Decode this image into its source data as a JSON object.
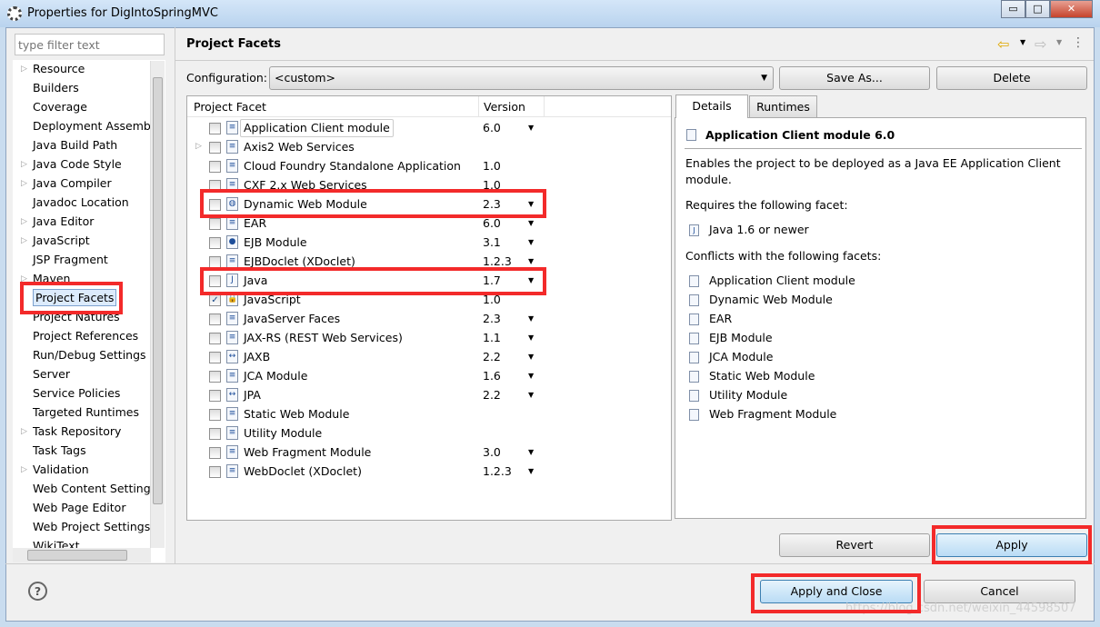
{
  "window": {
    "title": "Properties for DigIntoSpringMVC",
    "minimize": "▭",
    "maximize": "□",
    "close": "✕"
  },
  "sidebar": {
    "filter_placeholder": "type filter text",
    "items": [
      {
        "label": "Resource",
        "expandable": true
      },
      {
        "label": "Builders"
      },
      {
        "label": "Coverage"
      },
      {
        "label": "Deployment Assembly"
      },
      {
        "label": "Java Build Path"
      },
      {
        "label": "Java Code Style",
        "expandable": true
      },
      {
        "label": "Java Compiler",
        "expandable": true
      },
      {
        "label": "Javadoc Location"
      },
      {
        "label": "Java Editor",
        "expandable": true
      },
      {
        "label": "JavaScript",
        "expandable": true
      },
      {
        "label": "JSP Fragment"
      },
      {
        "label": "Maven",
        "expandable": true
      },
      {
        "label": "Project Facets",
        "selected": true
      },
      {
        "label": "Project Natures"
      },
      {
        "label": "Project References"
      },
      {
        "label": "Run/Debug Settings"
      },
      {
        "label": "Server"
      },
      {
        "label": "Service Policies"
      },
      {
        "label": "Targeted Runtimes"
      },
      {
        "label": "Task Repository",
        "expandable": true
      },
      {
        "label": "Task Tags"
      },
      {
        "label": "Validation",
        "expandable": true
      },
      {
        "label": "Web Content Settings"
      },
      {
        "label": "Web Page Editor"
      },
      {
        "label": "Web Project Settings"
      },
      {
        "label": "WikiText"
      }
    ]
  },
  "page": {
    "title": "Project Facets",
    "nav": {
      "back": "⇦",
      "forward": "⇨",
      "menu": "⋮"
    }
  },
  "config": {
    "label": "Configuration:",
    "value": "<custom>",
    "save_as": "Save As...",
    "delete": "Delete"
  },
  "table": {
    "headers": [
      "Project Facet",
      "Version"
    ],
    "rows": [
      {
        "name": "Application Client module",
        "version": "6.0",
        "dropdown": true,
        "checked": false,
        "icon": "document-icon"
      },
      {
        "name": "Axis2 Web Services",
        "version": "",
        "checked": false,
        "expandable": true,
        "icon": "document-icon"
      },
      {
        "name": "Cloud Foundry Standalone Application",
        "version": "1.0",
        "checked": false,
        "icon": "document-icon"
      },
      {
        "name": "CXF 2.x Web Services",
        "version": "1.0",
        "checked": false,
        "icon": "document-icon"
      },
      {
        "name": "Dynamic Web Module",
        "version": "2.3",
        "dropdown": true,
        "checked": false,
        "icon": "globe-jar-icon"
      },
      {
        "name": "EAR",
        "version": "6.0",
        "dropdown": true,
        "checked": false,
        "icon": "document-icon"
      },
      {
        "name": "EJB Module",
        "version": "3.1",
        "dropdown": true,
        "checked": false,
        "icon": "bean-jar-icon"
      },
      {
        "name": "EJBDoclet (XDoclet)",
        "version": "1.2.3",
        "dropdown": true,
        "checked": false,
        "icon": "document-icon"
      },
      {
        "name": "Java",
        "version": "1.7",
        "dropdown": true,
        "checked": false,
        "icon": "java-file-icon"
      },
      {
        "name": "JavaScript",
        "version": "1.0",
        "checked": true,
        "icon": "locked-document-icon"
      },
      {
        "name": "JavaServer Faces",
        "version": "2.3",
        "dropdown": true,
        "checked": false,
        "icon": "document-icon"
      },
      {
        "name": "JAX-RS (REST Web Services)",
        "version": "1.1",
        "dropdown": true,
        "checked": false,
        "icon": "document-icon"
      },
      {
        "name": "JAXB",
        "version": "2.2",
        "dropdown": true,
        "checked": false,
        "icon": "arrows-icon"
      },
      {
        "name": "JCA Module",
        "version": "1.6",
        "dropdown": true,
        "checked": false,
        "icon": "document-icon"
      },
      {
        "name": "JPA",
        "version": "2.2",
        "dropdown": true,
        "checked": false,
        "icon": "arrows-icon"
      },
      {
        "name": "Static Web Module",
        "version": "",
        "checked": false,
        "icon": "document-icon"
      },
      {
        "name": "Utility Module",
        "version": "",
        "checked": false,
        "icon": "document-icon"
      },
      {
        "name": "Web Fragment Module",
        "version": "3.0",
        "dropdown": true,
        "checked": false,
        "icon": "document-icon"
      },
      {
        "name": "WebDoclet (XDoclet)",
        "version": "1.2.3",
        "dropdown": true,
        "checked": false,
        "icon": "document-icon"
      }
    ]
  },
  "details": {
    "tabs": [
      "Details",
      "Runtimes"
    ],
    "heading": "Application Client module 6.0",
    "description1": "Enables the project to be deployed as a Java EE Application Client",
    "description2": "module.",
    "requires_label": "Requires the following facet:",
    "requires": [
      "Java 1.6 or newer"
    ],
    "conflicts_label": "Conflicts with the following facets:",
    "conflicts": [
      "Application Client module",
      "Dynamic Web Module",
      "EAR",
      "EJB Module",
      "JCA Module",
      "Static Web Module",
      "Utility Module",
      "Web Fragment Module"
    ]
  },
  "buttons": {
    "revert": "Revert",
    "apply": "Apply",
    "apply_close": "Apply and Close",
    "cancel": "Cancel",
    "help": "?"
  },
  "highlight_color": "#f32a2a",
  "watermark": "https://blog.csdn.net/weixin_44598507"
}
